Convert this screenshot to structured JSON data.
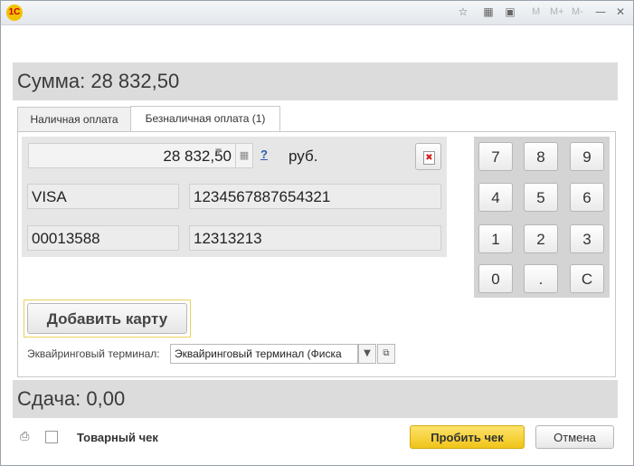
{
  "titlebar": {
    "logo_text": "1С",
    "icons": [
      "favorites-icon",
      "calculator-icon",
      "calendar-icon"
    ],
    "memory_buttons": [
      "M",
      "M+",
      "M-"
    ],
    "window_buttons": [
      "minimize-icon",
      "maximize-icon",
      "close-icon"
    ]
  },
  "header": {
    "sum_label": "Сумма: 28 832,50"
  },
  "tabs": [
    {
      "label": "Наличная оплата",
      "active": false
    },
    {
      "label": "Безналичная оплата (1)",
      "active": true
    }
  ],
  "payment": {
    "amount": "28 832,50",
    "help": "?",
    "currency": "руб.",
    "card_type": "VISA",
    "card_number": "1234567887654321",
    "field3": "00013588",
    "field4": "12313213"
  },
  "numpad": {
    "keys": [
      "7",
      "8",
      "9",
      "4",
      "5",
      "6",
      "1",
      "2",
      "3",
      "0",
      ".",
      "C"
    ]
  },
  "add_card_label": "Добавить карту",
  "terminal": {
    "label": "Эквайринговый терминал:",
    "value": "Эквайринговый терминал  (Фиска"
  },
  "change": {
    "label": "Сдача:  0,00"
  },
  "footer": {
    "receipt_label": "Товарный чек",
    "receipt_checked": false,
    "print_button": "Пробить чек",
    "cancel_button": "Отмена"
  },
  "colors": {
    "accent": "#f5cf2a",
    "panel_bg": "#dcdcdc"
  }
}
